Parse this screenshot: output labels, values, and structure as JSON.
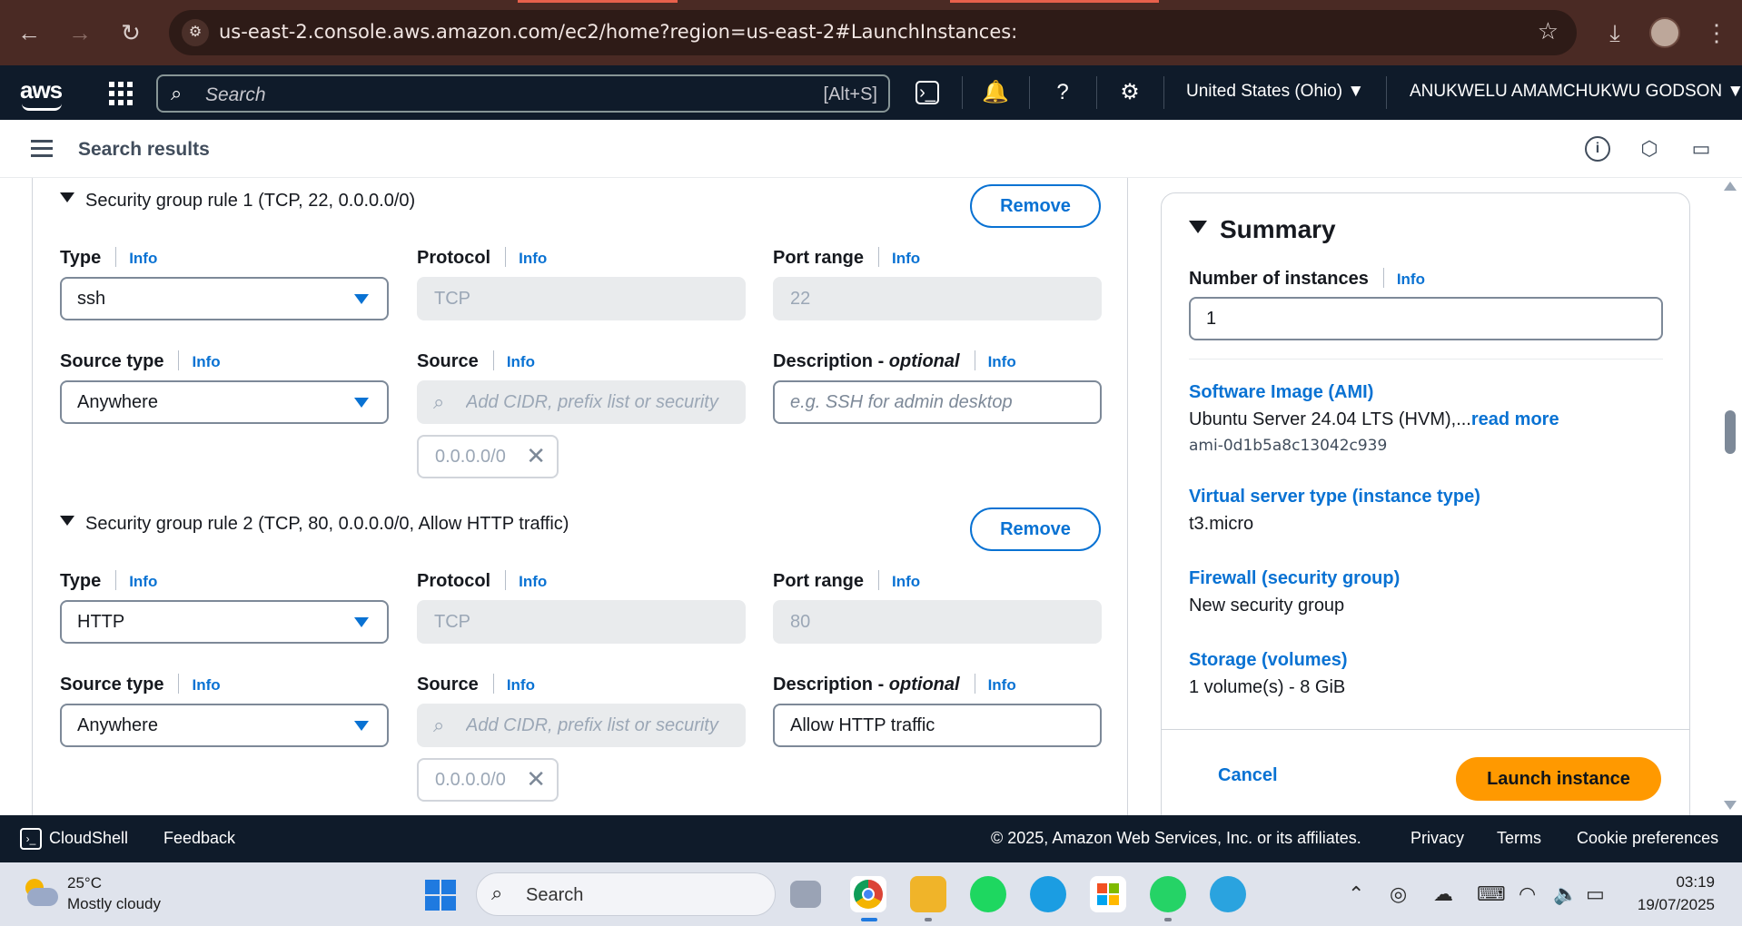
{
  "browser": {
    "url": "us-east-2.console.aws.amazon.com/ec2/home?region=us-east-2#LaunchInstances:"
  },
  "aws_nav": {
    "logo": "aws",
    "search_placeholder": "Search",
    "search_shortcut": "[Alt+S]",
    "region": "United States (Ohio) ▼",
    "account": "ANUKWELU AMAMCHUKWU GODSON ▼"
  },
  "subheader": {
    "title": "Search results"
  },
  "rules": [
    {
      "heading": "Security group rule 1 (TCP, 22, 0.0.0.0/0)",
      "remove_label": "Remove",
      "type_label": "Type",
      "type_value": "ssh",
      "protocol_label": "Protocol",
      "protocol_value": "TCP",
      "port_label": "Port range",
      "port_value": "22",
      "source_type_label": "Source type",
      "source_type_value": "Anywhere",
      "source_label": "Source",
      "source_placeholder": "Add CIDR, prefix list or security",
      "source_token": "0.0.0.0/0",
      "desc_label": "Description - ",
      "desc_optional": "optional",
      "desc_value": "",
      "desc_placeholder": "e.g. SSH for admin desktop",
      "info": "Info"
    },
    {
      "heading": "Security group rule 2 (TCP, 80, 0.0.0.0/0, Allow HTTP traffic)",
      "remove_label": "Remove",
      "type_label": "Type",
      "type_value": "HTTP",
      "protocol_label": "Protocol",
      "protocol_value": "TCP",
      "port_label": "Port range",
      "port_value": "80",
      "source_type_label": "Source type",
      "source_type_value": "Anywhere",
      "source_label": "Source",
      "source_placeholder": "Add CIDR, prefix list or security",
      "source_token": "0.0.0.0/0",
      "desc_label": "Description - ",
      "desc_optional": "optional",
      "desc_value": "Allow HTTP traffic",
      "desc_placeholder": "",
      "info": "Info"
    }
  ],
  "summary": {
    "title": "Summary",
    "num_instances_label": "Number of instances",
    "info": "Info",
    "num_instances_value": "1",
    "ami_label": "Software Image (AMI)",
    "ami_value": "Ubuntu Server 24.04 LTS (HVM),...",
    "ami_read_more": "read more",
    "ami_id": "ami-0d1b5a8c13042c939",
    "instance_type_label": "Virtual server type (instance type)",
    "instance_type_value": "t3.micro",
    "firewall_label": "Firewall (security group)",
    "firewall_value": "New security group",
    "storage_label": "Storage (volumes)",
    "storage_value": "1 volume(s) - 8 GiB",
    "cancel_label": "Cancel",
    "launch_label": "Launch instance"
  },
  "aws_footer": {
    "cloudshell": "CloudShell",
    "feedback": "Feedback",
    "copyright": "© 2025, Amazon Web Services, Inc. or its affiliates.",
    "privacy": "Privacy",
    "terms": "Terms",
    "cookie": "Cookie preferences"
  },
  "taskbar": {
    "temperature": "25°C",
    "weather": "Mostly cloudy",
    "search": "Search",
    "time": "03:19",
    "date": "19/07/2025"
  },
  "colors": {
    "accent": "#0972d3",
    "launch": "#ff9900",
    "nav_bg": "#0f1b2a",
    "browser_bg": "#4a2a24"
  }
}
